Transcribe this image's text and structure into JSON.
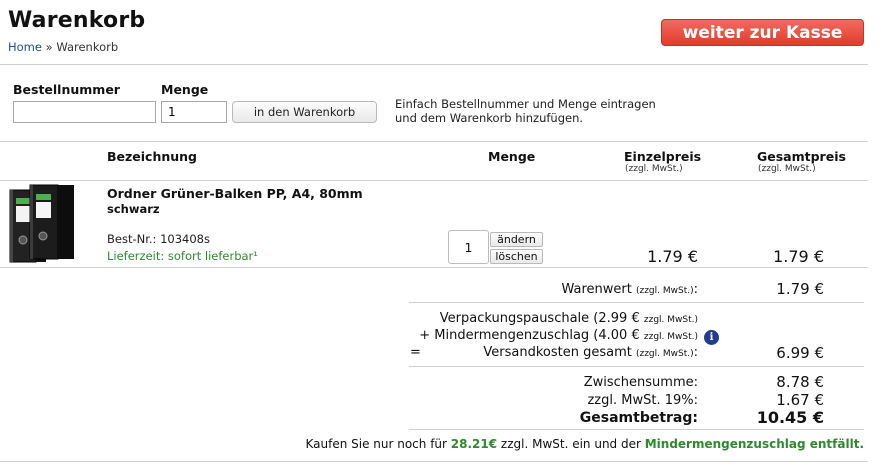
{
  "page": {
    "title": "Warenkorb"
  },
  "breadcrumb": {
    "home": "Home",
    "separator": " » ",
    "current": "Warenkorb"
  },
  "header": {
    "checkout_button": "weiter zur Kasse"
  },
  "quick_add": {
    "article_label": "Bestellnummer",
    "quantity_label": "Menge",
    "article_value": "",
    "quantity_value": "1",
    "add_button": "in den Warenkorb",
    "hint_line1": "Einfach Bestellnummer und Menge eintragen",
    "hint_line2": "und dem Warenkorb hinzufügen."
  },
  "table": {
    "col_name": "Bezeichnung",
    "col_qty": "Menge",
    "col_unit": "Einzelpreis",
    "col_unit_sub": "(zzgl. MwSt.)",
    "col_total": "Gesamtpreis",
    "col_total_sub": "(zzgl. MwSt.)"
  },
  "items": [
    {
      "name": "Ordner Grüner-Balken PP, A4, 80mm",
      "variant": "schwarz",
      "sku_label": "Best-Nr.:",
      "sku": "103408s",
      "delivery": "Lieferzeit: sofort lieferbar¹",
      "quantity": "1",
      "change_button": "ändern",
      "delete_button": "löschen",
      "unit_price": "1.79 €",
      "total_price": "1.79 €"
    }
  ],
  "summary": {
    "warenwert_label": "Warenwert",
    "vat_note": "(zzgl. MwSt.)",
    "warenwert_value": "1.79 €",
    "packaging_label": "Verpackungspauschale (2.99 €",
    "packaging_note": "zzgl. MwSt.)",
    "minqty_label": "+ Mindermengenzuschlag (4.00 €",
    "minqty_note": "zzgl. MwSt.)",
    "shipping_prefix": "=",
    "shipping_label": "Versandkosten gesamt",
    "shipping_value": "6.99 €",
    "subtotal_label": "Zwischensumme:",
    "subtotal_value": "8.78 €",
    "vat_label": "zzgl. MwSt. 19%:",
    "vat_value": "1.67 €",
    "total_label": "Gesamtbetrag:",
    "total_value": "10.45 €",
    "colon": ":"
  },
  "footer": {
    "text1": "Kaufen Sie nur noch für ",
    "amount": "28.21€",
    "text2": " zzgl. MwSt. ein und der ",
    "highlight": "Mindermengenzuschlag entfällt."
  },
  "colors": {
    "accent_red": "#e03c2e",
    "green": "#2f8a2f",
    "link": "#1f4f8f",
    "info": "#223b8f"
  },
  "icons": {
    "info": "info-icon",
    "product": "binder-product-image"
  }
}
